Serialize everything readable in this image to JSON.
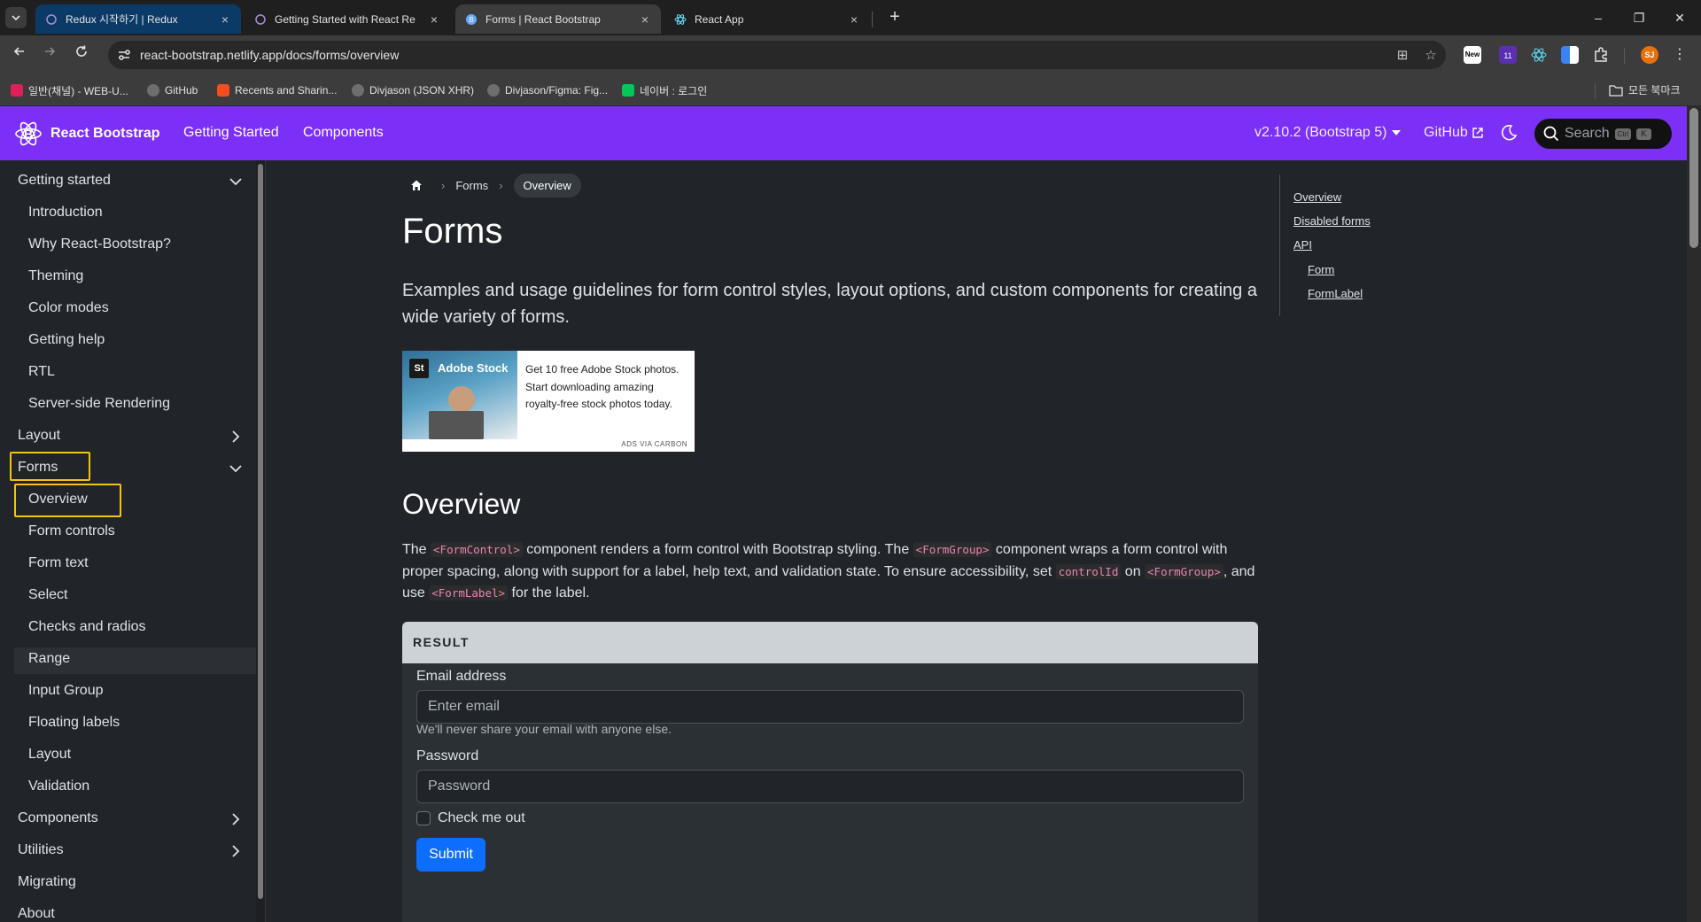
{
  "browser": {
    "tabs": [
      {
        "title": "Redux 시작하기 | Redux",
        "favicon": "redux-icon",
        "close": "×"
      },
      {
        "title": "Getting Started with React Re",
        "favicon": "redux-icon",
        "close": "×"
      },
      {
        "title": "Forms | React Bootstrap",
        "favicon": "bootstrap-icon",
        "close": "×"
      },
      {
        "title": "React App",
        "favicon": "react-icon",
        "close": "×"
      }
    ],
    "new_tab": "+",
    "window_controls": {
      "minimize": "–",
      "restore": "❐",
      "close": "✕"
    },
    "url": "react-bootstrap.netlify.app/docs/forms/overview",
    "bookmarks": [
      {
        "label": "일반(채널) - WEB-U...",
        "icon": "slack-icon",
        "color": "#e01e5a"
      },
      {
        "label": "GitHub",
        "icon": "github-icon",
        "color": "#6e6e6e"
      },
      {
        "label": "Recents and Sharin...",
        "icon": "figma-icon",
        "color": "#f24e1e"
      },
      {
        "label": "Divjason (JSON XHR)",
        "icon": "github-icon",
        "color": "#6e6e6e"
      },
      {
        "label": "Divjason/Figma: Fig...",
        "icon": "github-icon",
        "color": "#6e6e6e"
      },
      {
        "label": "네이버 : 로그인",
        "icon": "naver-icon",
        "color": "#03c75a"
      }
    ],
    "all_bookmarks": "모든 북마크",
    "extension_badge": "11",
    "extension_new": "New",
    "profile_initials": "SJ"
  },
  "site": {
    "brand": "React Bootstrap",
    "nav_links": [
      "Getting Started",
      "Components"
    ],
    "version": "v2.10.2 (Bootstrap 5)",
    "github": "GitHub",
    "search_placeholder": "Search",
    "kbd_ctrl": "Ctrl",
    "kbd_k": "K",
    "accent": "#7b2ff7"
  },
  "sidebar": {
    "groups": [
      {
        "label": "Getting started",
        "expanded": true,
        "items": [
          "Introduction",
          "Why React-Bootstrap?",
          "Theming",
          "Color modes",
          "Getting help",
          "RTL",
          "Server-side Rendering"
        ]
      },
      {
        "label": "Layout",
        "expanded": false
      },
      {
        "label": "Forms",
        "expanded": true,
        "items": [
          "Overview",
          "Form controls",
          "Form text",
          "Select",
          "Checks and radios",
          "Range",
          "Input Group",
          "Floating labels",
          "Layout",
          "Validation"
        ]
      },
      {
        "label": "Components",
        "expanded": false
      },
      {
        "label": "Utilities",
        "expanded": false
      },
      {
        "label": "Migrating"
      },
      {
        "label": "About"
      }
    ],
    "active_item": "Overview"
  },
  "breadcrumb": {
    "items": [
      "Forms",
      "Overview"
    ]
  },
  "page": {
    "title": "Forms",
    "lead": "Examples and usage guidelines for form control styles, layout options, and custom components for creating a wide variety of forms.",
    "ad": {
      "brand": "Adobe Stock",
      "brand_mark": "St",
      "text": "Get 10 free Adobe Stock photos. Start downloading amazing royalty-free stock photos today.",
      "via": "ADS VIA CARBON"
    },
    "section_title": "Overview",
    "paragraph": {
      "t1": "The ",
      "c1": "<FormControl>",
      "t2": " component renders a form control with Bootstrap styling. The ",
      "c2": "<FormGroup>",
      "t3": " component wraps a form control with proper spacing, along with support for a label, help text, and validation state. To ensure accessibility, set ",
      "c3": "controlId",
      "t4": " on ",
      "c4": "<FormGroup>",
      "t5": ", and use ",
      "c5": "<FormLabel>",
      "t6": " for the label."
    },
    "example": {
      "header": "RESULT",
      "email_label": "Email address",
      "email_placeholder": "Enter email",
      "email_help": "We'll never share your email with anyone else.",
      "password_label": "Password",
      "password_placeholder": "Password",
      "check_label": "Check me out",
      "submit": "Submit"
    }
  },
  "toc": {
    "links": [
      "Overview",
      "Disabled forms",
      "API"
    ],
    "sub_links": [
      "Form",
      "FormLabel"
    ]
  }
}
